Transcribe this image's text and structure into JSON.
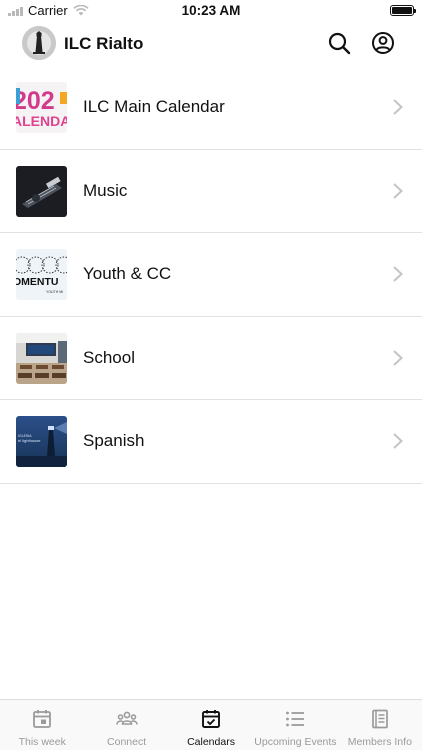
{
  "status_bar": {
    "carrier": "Carrier",
    "time": "10:23 AM"
  },
  "header": {
    "title": "ILC Rialto",
    "logo_icon": "lighthouse-logo-icon",
    "search_icon": "search-icon",
    "account_icon": "account-circle-icon"
  },
  "calendars": [
    {
      "name": "ILC Main Calendar",
      "thumb_text_top": "202",
      "thumb_text_bottom": "ALENDA"
    },
    {
      "name": "Music"
    },
    {
      "name": "Youth & CC",
      "thumb_text": "OMENTU",
      "thumb_small": "YOUTH MI"
    },
    {
      "name": "School"
    },
    {
      "name": "Spanish",
      "thumb_text_1": "IGLESIA",
      "thumb_text_2": "el lighthouse"
    }
  ],
  "tabs": [
    {
      "label": "This week",
      "icon": "calendar-day-icon",
      "active": false
    },
    {
      "label": "Connect",
      "icon": "people-group-icon",
      "active": false
    },
    {
      "label": "Calendars",
      "icon": "calendar-check-icon",
      "active": true
    },
    {
      "label": "Upcoming Events",
      "icon": "list-icon",
      "active": false
    },
    {
      "label": "Members Info",
      "icon": "document-icon",
      "active": false
    }
  ],
  "colors": {
    "active_tab": "#111111",
    "inactive_tab": "#9a9a9a",
    "divider": "#e2e2e2"
  }
}
